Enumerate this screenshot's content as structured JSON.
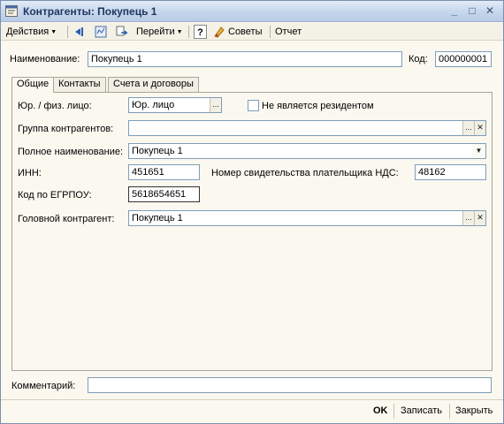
{
  "window": {
    "title": "Контрагенты: Покупець 1",
    "controls": {
      "minimize": "_",
      "maximize": "□",
      "close": "✕"
    }
  },
  "toolbar": {
    "actions_label": "Действия",
    "goto_label": "Перейти",
    "help_label": "?",
    "tips_label": "Советы",
    "report_label": "Отчет"
  },
  "header": {
    "name_label": "Наименование:",
    "name_value": "Покупець 1",
    "code_label": "Код:",
    "code_value": "000000001"
  },
  "tabs": [
    {
      "label": "Общие",
      "active": true
    },
    {
      "label": "Контакты",
      "active": false
    },
    {
      "label": "Счета и договоры",
      "active": false
    }
  ],
  "general": {
    "entity_type_label": "Юр. / физ. лицо:",
    "entity_type_value": "Юр. лицо",
    "non_resident_label": "Не является резидентом",
    "non_resident_checked": false,
    "group_label": "Группа контрагентов:",
    "group_value": "",
    "full_name_label": "Полное наименование:",
    "full_name_value": "Покупець 1",
    "inn_label": "ИНН:",
    "inn_value": "451651",
    "vat_cert_label": "Номер свидетельства плательщика НДС:",
    "vat_cert_value": "48162",
    "edrpou_label": "Код по ЕГРПОУ:",
    "edrpou_value": "5618654651",
    "parent_label": "Головной контрагент:",
    "parent_value": "Покупець 1"
  },
  "comment": {
    "label": "Комментарий:",
    "value": ""
  },
  "footer": {
    "ok_label": "OK",
    "save_label": "Записать",
    "close_label": "Закрыть"
  },
  "colors": {
    "window_bg": "#fbf8ef",
    "titlebar": "#c8d8ec",
    "field_border": "#7f9db9"
  }
}
